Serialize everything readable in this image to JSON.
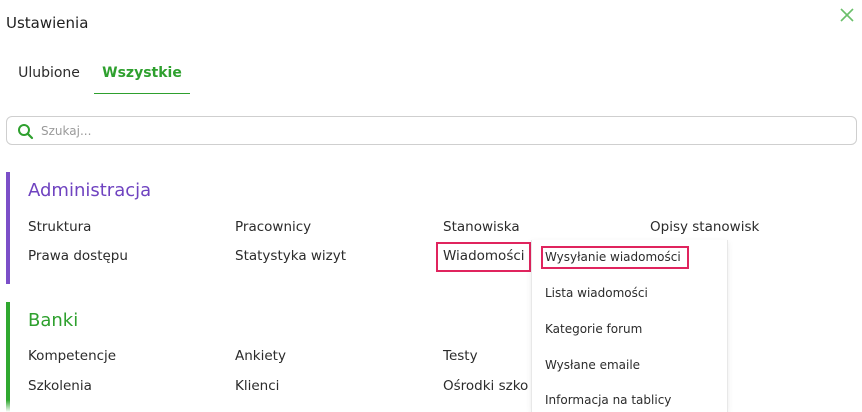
{
  "window": {
    "title": "Ustawienia"
  },
  "tabs": [
    {
      "label": "Ulubione"
    },
    {
      "label": "Wszystkie"
    }
  ],
  "search": {
    "placeholder": "Szukaj..."
  },
  "sections": [
    {
      "heading": "Administracja",
      "color": "#6f43c0",
      "items": [
        "Struktura",
        "Pracownicy",
        "Stanowiska",
        "Opisy stanowisk",
        "Prawa dostępu",
        "Statystyka wizyt",
        "Wiadomości"
      ]
    },
    {
      "heading": "Banki",
      "color": "#2ea02e",
      "items": [
        "Kompetencje",
        "Ankiety",
        "Testy",
        "Szkolenia",
        "Klienci",
        "Ośrodki szko"
      ]
    }
  ],
  "flyout": {
    "items": [
      "Wysyłanie wiadomości",
      "Lista wiadomości",
      "Kategorie forum",
      "Wysłane emaile",
      "Informacja na tablicy"
    ]
  },
  "colors": {
    "accent_green": "#2ea02e",
    "accent_purple": "#6f43c0",
    "highlight": "#e0245e"
  },
  "icons": {
    "close": "close-icon",
    "search": "search-icon"
  }
}
